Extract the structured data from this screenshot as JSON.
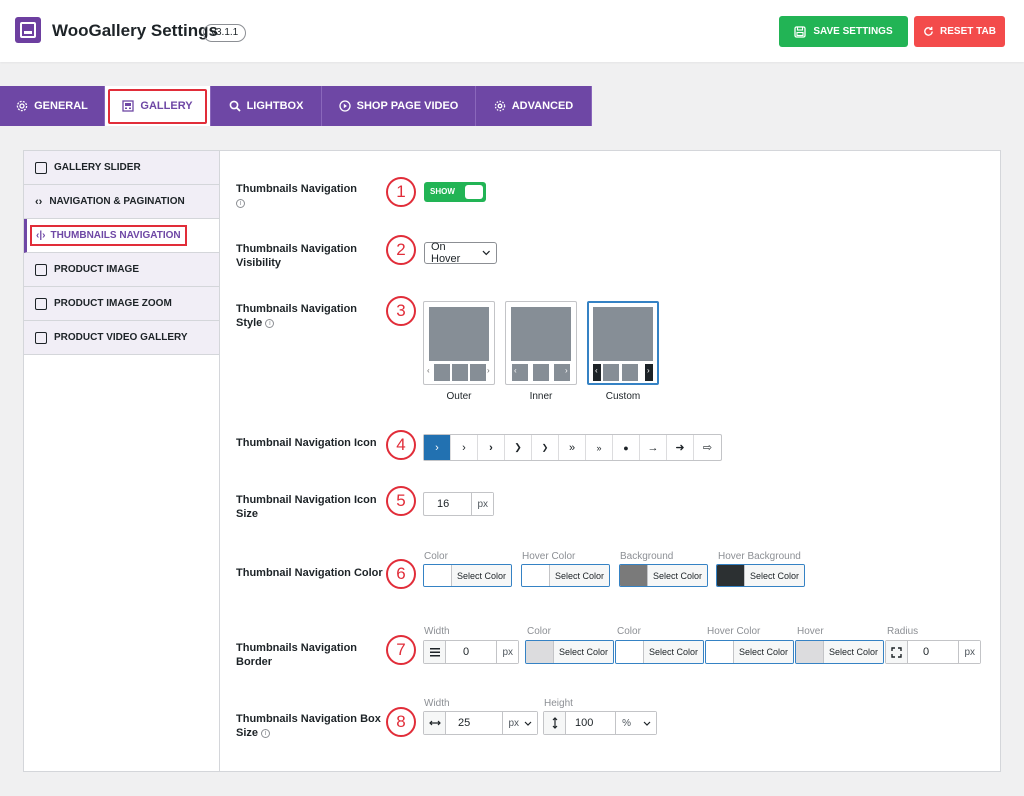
{
  "header": {
    "title": "WooGallery Settings",
    "version": "v3.1.1",
    "save_label": "SAVE SETTINGS",
    "reset_label": "RESET TAB"
  },
  "tabs": [
    {
      "label": "GENERAL",
      "icon": "gear-icon"
    },
    {
      "label": "GALLERY",
      "icon": "gallery-icon",
      "active": true
    },
    {
      "label": "LIGHTBOX",
      "icon": "search-icon"
    },
    {
      "label": "SHOP PAGE VIDEO",
      "icon": "play-icon"
    },
    {
      "label": "ADVANCED",
      "icon": "advanced-gear-icon"
    }
  ],
  "subnav": [
    {
      "label": "GALLERY SLIDER",
      "icon": "sliders-icon"
    },
    {
      "label": "NAVIGATION & PAGINATION",
      "icon": "code-arrows-icon"
    },
    {
      "label": "THUMBNAILS NAVIGATION",
      "icon": "thumb-nav-icon",
      "active": true
    },
    {
      "label": "PRODUCT IMAGE",
      "icon": "image-icon"
    },
    {
      "label": "PRODUCT IMAGE ZOOM",
      "icon": "zoom-icon"
    },
    {
      "label": "PRODUCT VIDEO GALLERY",
      "icon": "video-icon"
    }
  ],
  "settings": {
    "thumb_nav": {
      "label": "Thumbnails Navigation",
      "toggle": "SHOW",
      "num": "1"
    },
    "visibility": {
      "label": "Thumbnails Navigation Visibility",
      "value": "On Hover",
      "num": "2"
    },
    "style": {
      "label": "Thumbnails Navigation Style",
      "num": "3",
      "options": [
        "Outer",
        "Inner",
        "Custom"
      ],
      "selected": "Custom"
    },
    "icon": {
      "label": "Thumbnail Navigation Icon",
      "num": "4",
      "glyphs": [
        "›",
        "›",
        "›",
        "❯",
        "❯",
        "»",
        "»",
        "●",
        "→",
        "➜",
        "⇨"
      ]
    },
    "icon_size": {
      "label": "Thumbnail Navigation Icon Size",
      "num": "5",
      "value": "16",
      "unit": "px"
    },
    "color": {
      "label": "Thumbnail Navigation Color",
      "num": "6",
      "pickers": [
        {
          "title": "Color",
          "button": "Select Color",
          "swatch": "#ffffff"
        },
        {
          "title": "Hover Color",
          "button": "Select Color",
          "swatch": "#ffffff"
        },
        {
          "title": "Background",
          "button": "Select Color",
          "swatch": "#7a7a7a"
        },
        {
          "title": "Hover Background",
          "button": "Select Color",
          "swatch": "#2c3032"
        }
      ]
    },
    "border": {
      "label": "Thumbnails Navigation Border",
      "num": "7",
      "width_title": "Width",
      "width_value": "0",
      "width_unit": "px",
      "pickers": [
        {
          "title": "Color",
          "button": "Select Color",
          "swatch": "#dcdcde"
        },
        {
          "title": "Color",
          "button": "Select Color",
          "swatch": "#ffffff"
        },
        {
          "title": "Hover Color",
          "button": "Select Color",
          "swatch": "#ffffff"
        },
        {
          "title": "Hover",
          "button": "Select Color",
          "swatch": "#dcdcde"
        }
      ],
      "radius_title": "Radius",
      "radius_value": "0",
      "radius_unit": "px"
    },
    "box_size": {
      "label": "Thumbnails Navigation Box Size",
      "num": "8",
      "width_title": "Width",
      "width_value": "25",
      "width_unit": "px",
      "height_title": "Height",
      "height_value": "100",
      "height_unit": "%"
    }
  },
  "colors": {
    "accent": "#6e47a5",
    "save": "#22b455",
    "reset": "#f34b4b",
    "highlight": "#e12d39",
    "selected": "#2271b1"
  }
}
